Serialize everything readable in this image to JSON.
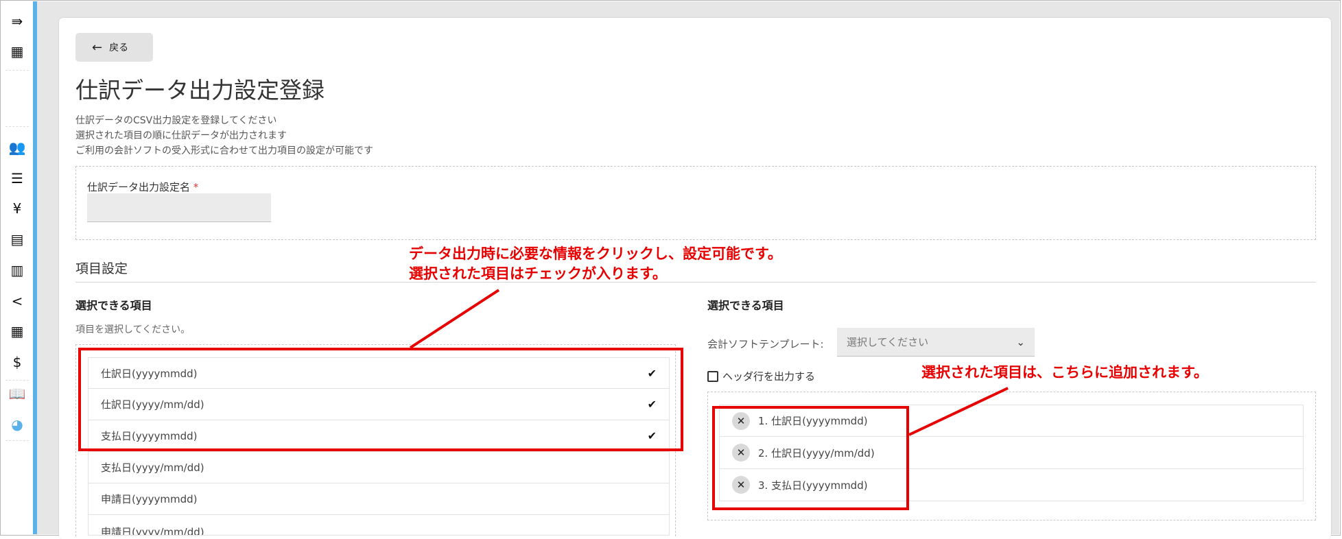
{
  "sidebar": {
    "icons": [
      "collapse-menu-icon",
      "building-icon",
      "users-icon",
      "list-icon",
      "yen-icon",
      "document-icon",
      "receipt-icon",
      "share-icon",
      "table-icon",
      "dollar-file-icon",
      "book-icon",
      "dashboard-icon"
    ],
    "glyphs": [
      "⇛",
      "▦",
      "👥",
      "☰",
      "¥",
      "▤",
      "▥",
      "<",
      "▦",
      "$",
      "📖",
      "◕"
    ]
  },
  "header": {
    "back_arrow": "←",
    "back_label": "戻る"
  },
  "page": {
    "title": "仕訳データ出力設定登録",
    "desc": [
      "仕訳データのCSV出力設定を登録してください",
      "選択された項目の順に仕訳データが出力されます",
      "ご利用の会計ソフトの受入形式に合わせて出力項目の設定が可能です"
    ]
  },
  "form": {
    "name_label": "仕訳データ出力設定名",
    "required_mark": "*",
    "name_value": ""
  },
  "items": {
    "section_title": "項目設定",
    "left_title": "選択できる項目",
    "left_hint": "項目を選択してください。",
    "check_glyph": "✔",
    "left_items": [
      {
        "label": "仕訳日(yyyymmdd)",
        "checked": true
      },
      {
        "label": "仕訳日(yyyy/mm/dd)",
        "checked": true
      },
      {
        "label": "支払日(yyyymmdd)",
        "checked": true
      },
      {
        "label": "支払日(yyyy/mm/dd)",
        "checked": false
      },
      {
        "label": "申請日(yyyymmdd)",
        "checked": false
      },
      {
        "label": "申請日(yyyy/mm/dd)",
        "checked": false
      }
    ],
    "right_title": "選択できる項目",
    "template_label": "会計ソフトテンプレート:",
    "template_placeholder": "選択してください",
    "template_caret": "⌄",
    "header_row_label": "ヘッダ行を出力する",
    "header_row_checked": false,
    "remove_glyph": "✕",
    "selected_items": [
      {
        "index": "1.",
        "label": "仕訳日(yyyymmdd)"
      },
      {
        "index": "2.",
        "label": "仕訳日(yyyy/mm/dd)"
      },
      {
        "index": "3.",
        "label": "支払日(yyyymmdd)"
      }
    ]
  },
  "annotations": {
    "left_line1": "データ出力時に必要な情報をクリックし、設定可能です。",
    "left_line2": "選択された項目はチェックが入ります。",
    "right": "選択された項目は、こちらに追加されます。",
    "color": "#e60000"
  }
}
